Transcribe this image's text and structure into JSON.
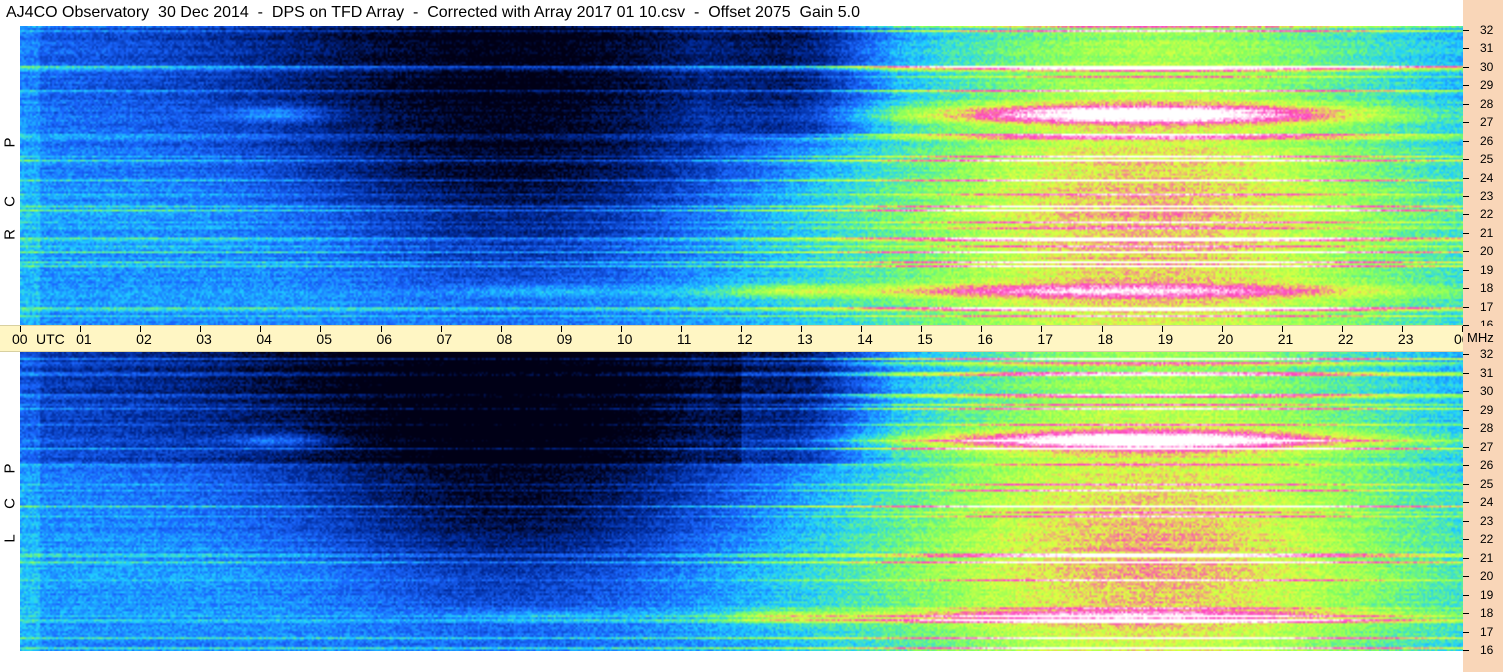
{
  "header": {
    "title": "AJ4CO Observatory  30 Dec 2014  -  DPS on TFD Array  -  Corrected with Array 2017 01 10.csv  -  Offset 2075  Gain 5.0"
  },
  "panels": {
    "top_label": [
      "R",
      "C",
      "P"
    ],
    "bottom_label": [
      "L",
      "C",
      "P"
    ]
  },
  "colors": {
    "freq_axis_bg": "#f9d6b8",
    "time_axis_bg": "#fff6c4"
  },
  "chart_data": {
    "type": "heatmap",
    "colormap": [
      "#000016",
      "#002a9a",
      "#1a66ff",
      "#20d0ff",
      "#80ff60",
      "#e0ff40",
      "#ff40c0",
      "#ffffff"
    ],
    "x": {
      "label": "UTC",
      "ticks": [
        "00",
        "01",
        "02",
        "03",
        "04",
        "05",
        "06",
        "07",
        "08",
        "09",
        "10",
        "11",
        "12",
        "13",
        "14",
        "15",
        "16",
        "17",
        "18",
        "19",
        "20",
        "21",
        "22",
        "23",
        "00"
      ],
      "range": [
        0,
        24
      ],
      "unit_label": "MHz"
    },
    "y": {
      "label": "MHz",
      "ticks": [
        "32",
        "31",
        "30",
        "29",
        "28",
        "27",
        "26",
        "25",
        "24",
        "23",
        "22",
        "21",
        "20",
        "19",
        "18",
        "17",
        "16"
      ],
      "range": [
        16,
        32
      ]
    },
    "series": [
      {
        "name": "RCP"
      },
      {
        "name": "LCP"
      }
    ]
  }
}
